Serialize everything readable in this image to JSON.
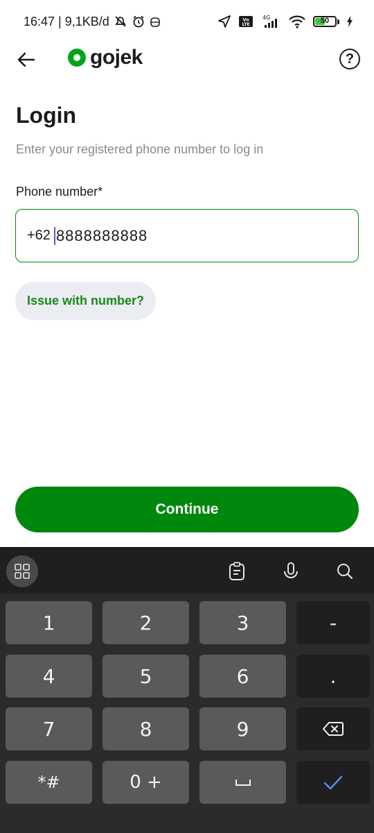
{
  "status_bar": {
    "time_network": "16:47 | 9,1KB/d",
    "network_label": "4G",
    "volte_label": "Vo LTE",
    "battery_level": "50"
  },
  "appbar": {
    "brand": "gojek",
    "help_glyph": "?"
  },
  "login": {
    "title": "Login",
    "subtitle": "Enter your registered phone number to log in",
    "phone_label": "Phone number*",
    "country_code": "+62",
    "phone_value": "8888888888",
    "issue_chip": "Issue with number?",
    "continue_label": "Continue"
  },
  "keyboard": {
    "keys": [
      "1",
      "2",
      "3",
      "-",
      "4",
      "5",
      "6",
      ".",
      "7",
      "8",
      "9",
      "*#",
      "0 +"
    ]
  },
  "colors": {
    "brand_green": "#00880d",
    "chip_bg": "#ececf3",
    "keyboard_bg": "#2b2b2b",
    "key_bg": "#5a5a5a"
  },
  "icons": [
    "back-arrow-icon",
    "gojek-logo-icon",
    "help-icon",
    "grid-icon",
    "clipboard-icon",
    "microphone-icon",
    "search-icon",
    "backspace-icon",
    "space-icon",
    "check-icon"
  ]
}
